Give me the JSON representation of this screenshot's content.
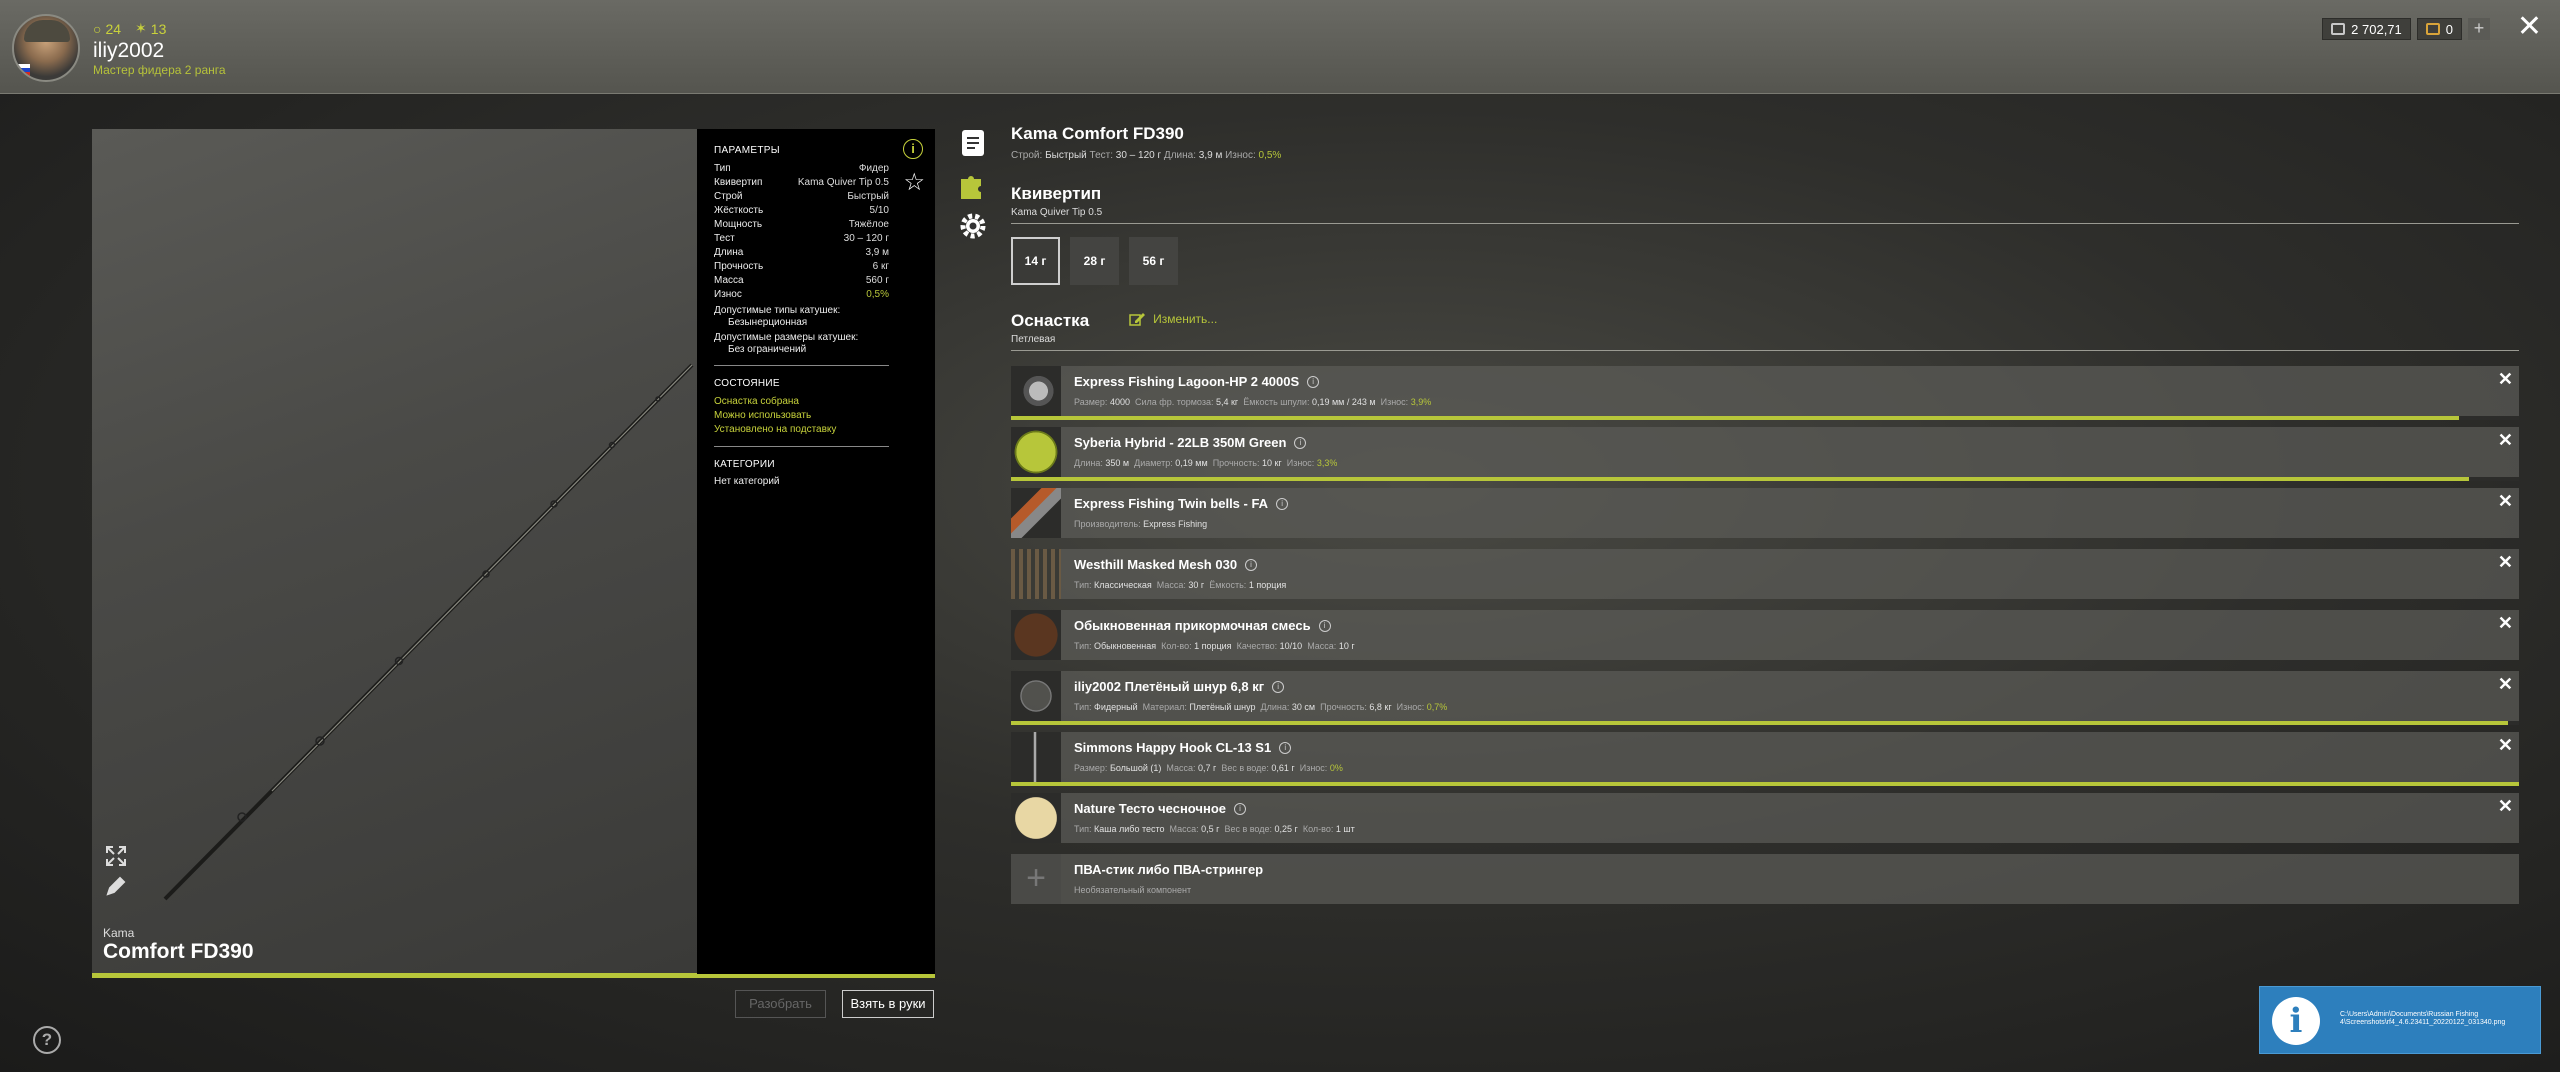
{
  "header": {
    "level_a": "24",
    "level_b": "13",
    "username": "iliy2002",
    "rank": "Мастер фидера 2 ранга",
    "silver": "2 702,71",
    "gold": "0",
    "plus": "+",
    "close": "✕"
  },
  "rod": {
    "brand": "Kama",
    "name": "Comfort FD390",
    "condition_progress": 1.0,
    "params_title": "ПАРАМЕТРЫ",
    "params": [
      {
        "k": "Тип",
        "v": "Фидер"
      },
      {
        "k": "Квивертип",
        "v": "Kama Quiver Tip 0.5"
      },
      {
        "k": "Строй",
        "v": "Быстрый"
      },
      {
        "k": "Жёсткость",
        "v": "5/10"
      },
      {
        "k": "Мощность",
        "v": "Тяжёлое"
      },
      {
        "k": "Тест",
        "v": "30 – 120 г"
      },
      {
        "k": "Длина",
        "v": "3,9 м"
      },
      {
        "k": "Прочность",
        "v": "6 кг"
      },
      {
        "k": "Масса",
        "v": "560 г"
      },
      {
        "k": "Износ",
        "v": "0,5%"
      }
    ],
    "reel_types_label": "Допустимые типы катушек:",
    "reel_types_value": "Безынерционная",
    "reel_sizes_label": "Допустимые размеры катушек:",
    "reel_sizes_value": "Без ограничений",
    "state_title": "СОСТОЯНИЕ",
    "states": [
      "Оснастка собрана",
      "Можно использовать",
      "Установлено на подставку"
    ],
    "categories_title": "КАТЕГОРИИ",
    "categories_value": "Нет категорий",
    "info_glyph": "i",
    "star_glyph": "☆",
    "btn_disassemble": "Разобрать",
    "btn_take": "Взять в руки"
  },
  "detail": {
    "title": "Kama Comfort FD390",
    "sub": {
      "action_label": "Строй:",
      "action": "Быстрый",
      "test_label": "Тест:",
      "test": "30 – 120 г",
      "length_label": "Длина:",
      "length": "3,9 м",
      "wear_label": "Износ:",
      "wear": "0,5%"
    },
    "quiver_title": "Квивертип",
    "quiver_name": "Kama Quiver Tip 0.5",
    "quiver_options": [
      "14 г",
      "28 г",
      "56 г"
    ],
    "rig_title": "Оснастка",
    "rig_type": "Петлевая",
    "change_label": "Изменить...",
    "items": [
      {
        "name": "Express Fishing Lagoon-HP 2 4000S",
        "desc": [
          [
            "Размер:",
            "4000"
          ],
          [
            "Сила фр. тормоза:",
            "5,4 кг"
          ],
          [
            "Ёмкость шпули:",
            "0,19 мм / 243 м"
          ],
          [
            "Износ:",
            "3,9%"
          ]
        ],
        "progress": 0.96
      },
      {
        "name": "Syberia Hybrid - 22LB 350M Green",
        "desc": [
          [
            "Длина:",
            "350 м"
          ],
          [
            "Диаметр:",
            "0,19 мм"
          ],
          [
            "Прочность:",
            "10 кг"
          ],
          [
            "Износ:",
            "3,3%"
          ]
        ],
        "progress": 0.967
      },
      {
        "name": "Express Fishing Twin bells - FA",
        "desc": [
          [
            "Производитель:",
            "Express Fishing"
          ]
        ]
      },
      {
        "name": "Westhill Masked Mesh 030",
        "desc": [
          [
            "Тип:",
            "Классическая"
          ],
          [
            "Масса:",
            "30 г"
          ],
          [
            "Ёмкость:",
            "1 порция"
          ]
        ]
      },
      {
        "name": "Обыкновенная прикормочная смесь",
        "desc": [
          [
            "Тип:",
            "Обыкновенная"
          ],
          [
            "Кол-во:",
            "1 порция"
          ],
          [
            "Качество:",
            "10/10"
          ],
          [
            "Масса:",
            "10 г"
          ]
        ]
      },
      {
        "name": "iliy2002 Плетёный шнур 6,8 кг",
        "desc": [
          [
            "Тип:",
            "Фидерный"
          ],
          [
            "Материал:",
            "Плетёный шнур"
          ],
          [
            "Длина:",
            "30 см"
          ],
          [
            "Прочность:",
            "6,8 кг"
          ],
          [
            "Износ:",
            "0,7%"
          ]
        ],
        "progress": 0.993
      },
      {
        "name": "Simmons Happy Hook CL-13 S1",
        "desc": [
          [
            "Размер:",
            "Большой (1)"
          ],
          [
            "Масса:",
            "0,7 г"
          ],
          [
            "Вес в воде:",
            "0,61 г"
          ],
          [
            "Износ:",
            "0%"
          ]
        ],
        "progress": 1.0
      },
      {
        "name": "Nature Тесто чесночное",
        "desc": [
          [
            "Тип:",
            "Каша либо тесто"
          ],
          [
            "Масса:",
            "0,5 г"
          ],
          [
            "Вес в воде:",
            "0,25 г"
          ],
          [
            "Кол-во:",
            "1 шт"
          ]
        ]
      }
    ],
    "empty_item": {
      "name": "ПВА-стик либо ПВА-стрингер",
      "desc": "Необязательный компонент"
    },
    "remove_glyph": "✕"
  },
  "notification": {
    "text": "C:\\Users\\Admin\\Documents\\Russian Fishing 4\\Screenshots\\rf4_4.6.23411_20220122_031340.png"
  },
  "help_glyph": "?"
}
